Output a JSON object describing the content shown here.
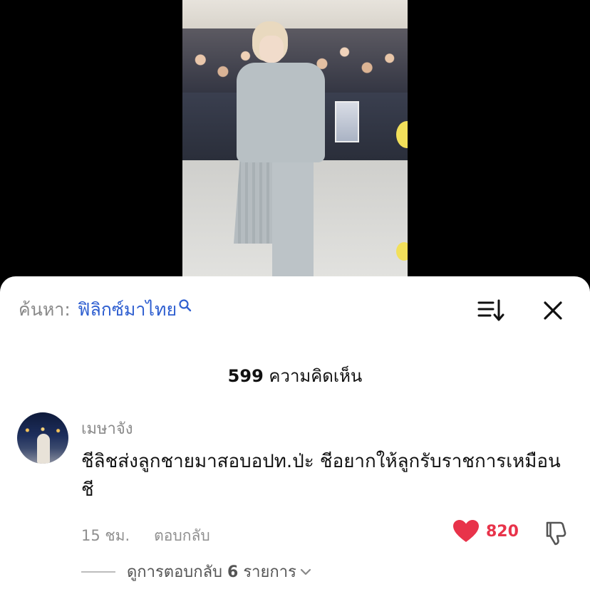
{
  "colors": {
    "accent_blue": "#2f5fd0",
    "like_red": "#e8334a",
    "muted_text": "#8a8a8a",
    "text": "#111111"
  },
  "video": {
    "icon": "video-frame"
  },
  "search": {
    "prefix": "ค้นหา:",
    "query": "ฟิลิกซ์มาไทย",
    "icon": "search-icon"
  },
  "toolbar": {
    "sort_icon": "sort-icon",
    "close_icon": "close-icon"
  },
  "comments_header": {
    "count": "599",
    "label": "ความคิดเห็น"
  },
  "comment": {
    "username": "เมษาจัง",
    "text": "ชีลิชส่งลูกชายมาสอบอปท.ป่ะ ชีอยากให้ลูกรับราชการเหมือนชี",
    "time": "15 ชม.",
    "reply_label": "ตอบกลับ",
    "likes": "820",
    "view_replies_prefix": "ดูการตอบกลับ",
    "replies_count": "6",
    "view_replies_suffix": "รายการ"
  }
}
